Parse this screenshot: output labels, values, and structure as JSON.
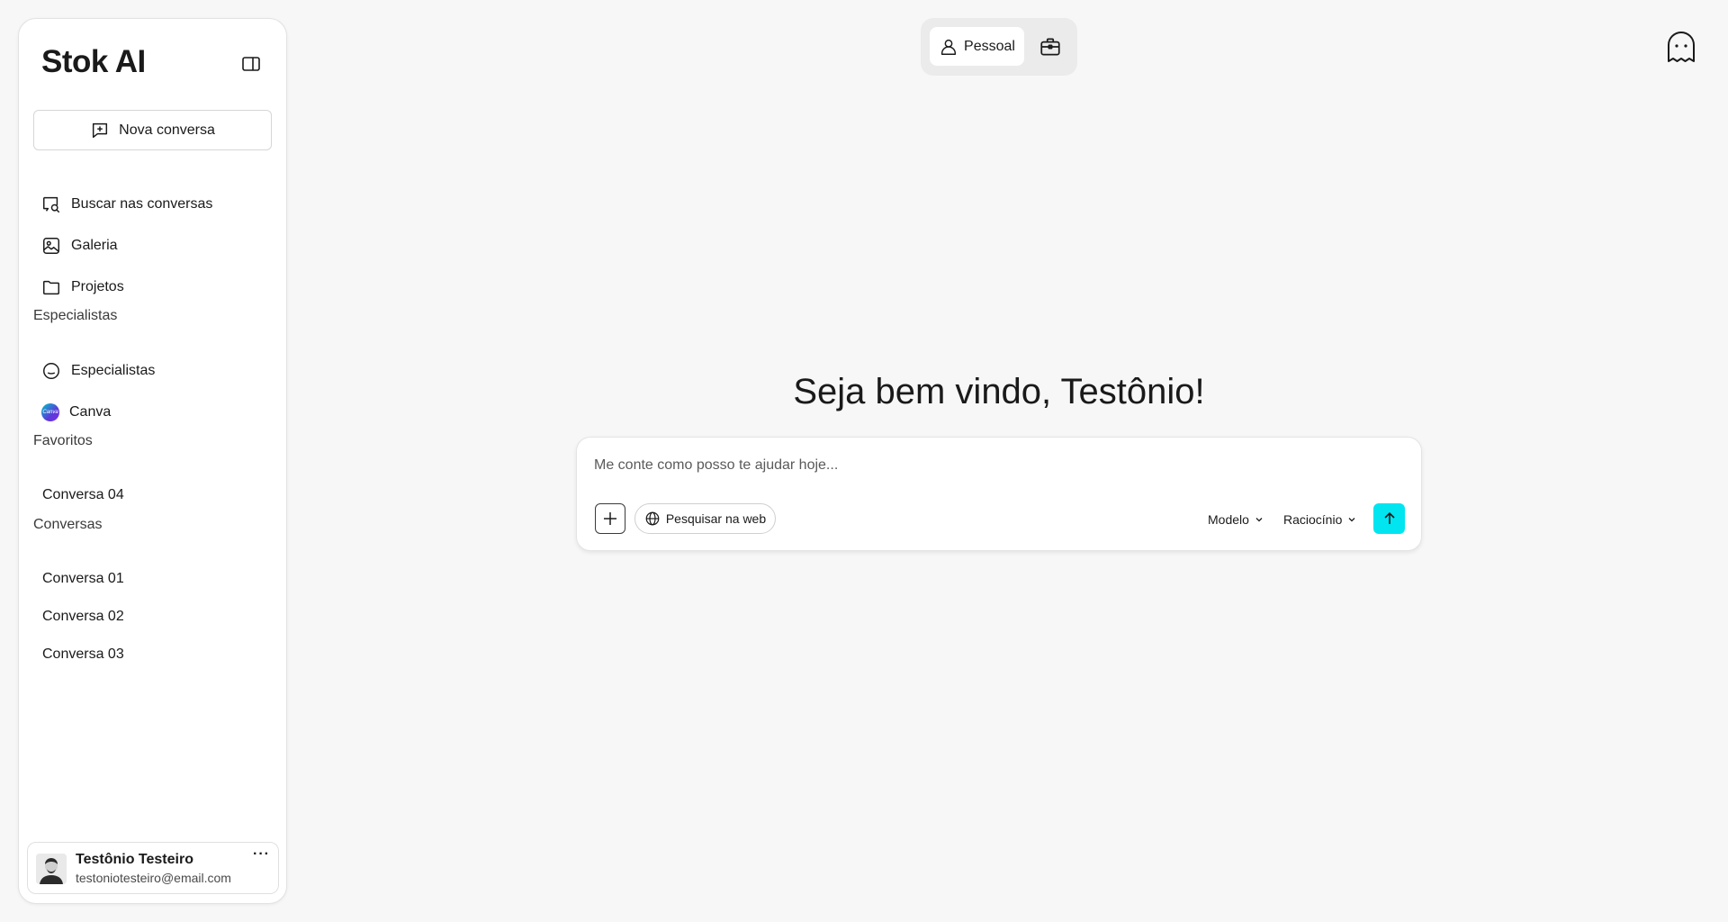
{
  "sidebar": {
    "brand": "Stok AI",
    "new_chat_label": "Nova conversa",
    "nav": [
      {
        "label": "Buscar nas conversas",
        "icon": "search-chat-icon"
      },
      {
        "label": "Galeria",
        "icon": "gallery-icon"
      },
      {
        "label": "Projetos",
        "icon": "folder-icon"
      }
    ],
    "specialists_section": "Especialistas",
    "specialists": [
      {
        "label": "Especialistas",
        "icon": "smiley-icon"
      },
      {
        "label": "Canva",
        "icon": "canva-icon",
        "icon_text": "Canva"
      }
    ],
    "favorites_section": "Favoritos",
    "favorites": [
      "Conversa 04"
    ],
    "conversations_section": "Conversas",
    "conversations": [
      "Conversa 01",
      "Conversa 02",
      "Conversa 03"
    ],
    "user": {
      "name": "Testônio Testeiro",
      "email": "testoniotesteiro@email.com",
      "menu": "···"
    }
  },
  "header": {
    "mode_personal": "Pessoal"
  },
  "main": {
    "welcome": "Seja bem vindo, Testônio!",
    "composer": {
      "placeholder": "Me conte como posso te ajudar hoje...",
      "web_search": "Pesquisar na web",
      "model": "Modelo",
      "reasoning": "Raciocínio"
    }
  },
  "colors": {
    "background": "#f7f7f7",
    "send_button": "#00e5f0",
    "panel": "#ffffff"
  }
}
